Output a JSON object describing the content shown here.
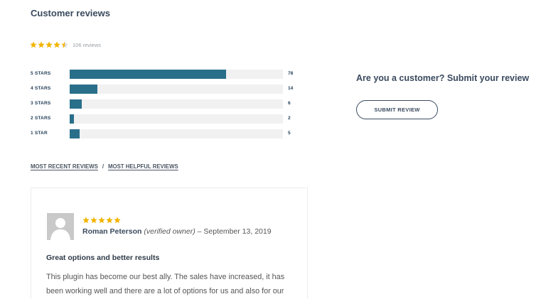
{
  "page": {
    "title": "Customer reviews"
  },
  "summary": {
    "rating": 4.5,
    "count_text": "106 reviews"
  },
  "colors": {
    "star": "#f2b400",
    "bar": "#2a6f8a",
    "track": "#f1f1f1",
    "heading": "#3a4a5e"
  },
  "breakdown": [
    {
      "label": "5 STARS",
      "count": "78",
      "value": 78
    },
    {
      "label": "4 STARS",
      "count": "14",
      "value": 14
    },
    {
      "label": "3 STARS",
      "count": "6",
      "value": 6
    },
    {
      "label": "2 STARS",
      "count": "2",
      "value": 2
    },
    {
      "label": "1 STAR",
      "count": "5",
      "value": 5
    }
  ],
  "cta": {
    "heading": "Are you a customer? Submit your review",
    "button_label": "SUBMIT REVIEW"
  },
  "sort": {
    "recent": "MOST RECENT REVIEWS",
    "separator": "/",
    "helpful": "MOST HELPFUL REVIEWS"
  },
  "review": {
    "rating": 5,
    "author": "Roman Peterson",
    "verified": "(verified owner)",
    "date": "– September 13, 2019",
    "title": "Great options and better results",
    "body": "This plugin has become our best ally. The sales have increased, it has been working well and there are a lot of options for us and also for our"
  }
}
